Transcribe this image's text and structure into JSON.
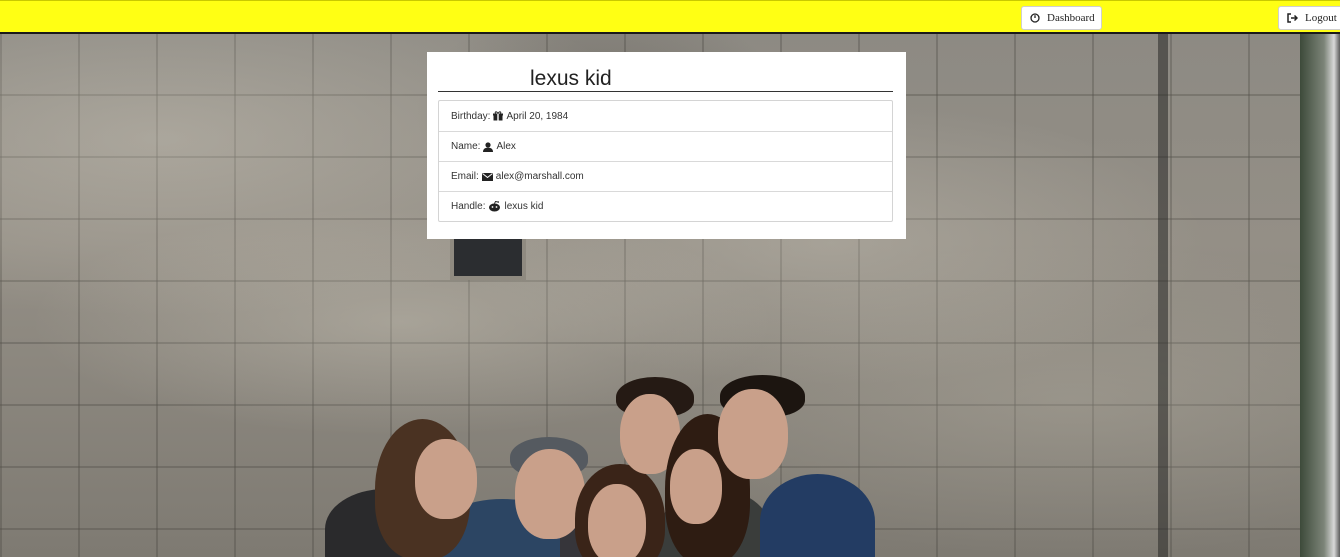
{
  "nav": {
    "dashboard_label": "Dashboard",
    "logout_label": "Logout",
    "bar_color": "#ffff14"
  },
  "profile": {
    "title": "lexus kid",
    "rows": [
      {
        "label": "Birthday:",
        "icon": "gift-icon",
        "value": "April 20, 1984"
      },
      {
        "label": "Name:",
        "icon": "user-icon",
        "value": "Alex"
      },
      {
        "label": "Email:",
        "icon": "envelope-icon",
        "value": "alex@marshall.com"
      },
      {
        "label": "Handle:",
        "icon": "reddit-icon",
        "value": "lexus kid"
      }
    ]
  }
}
